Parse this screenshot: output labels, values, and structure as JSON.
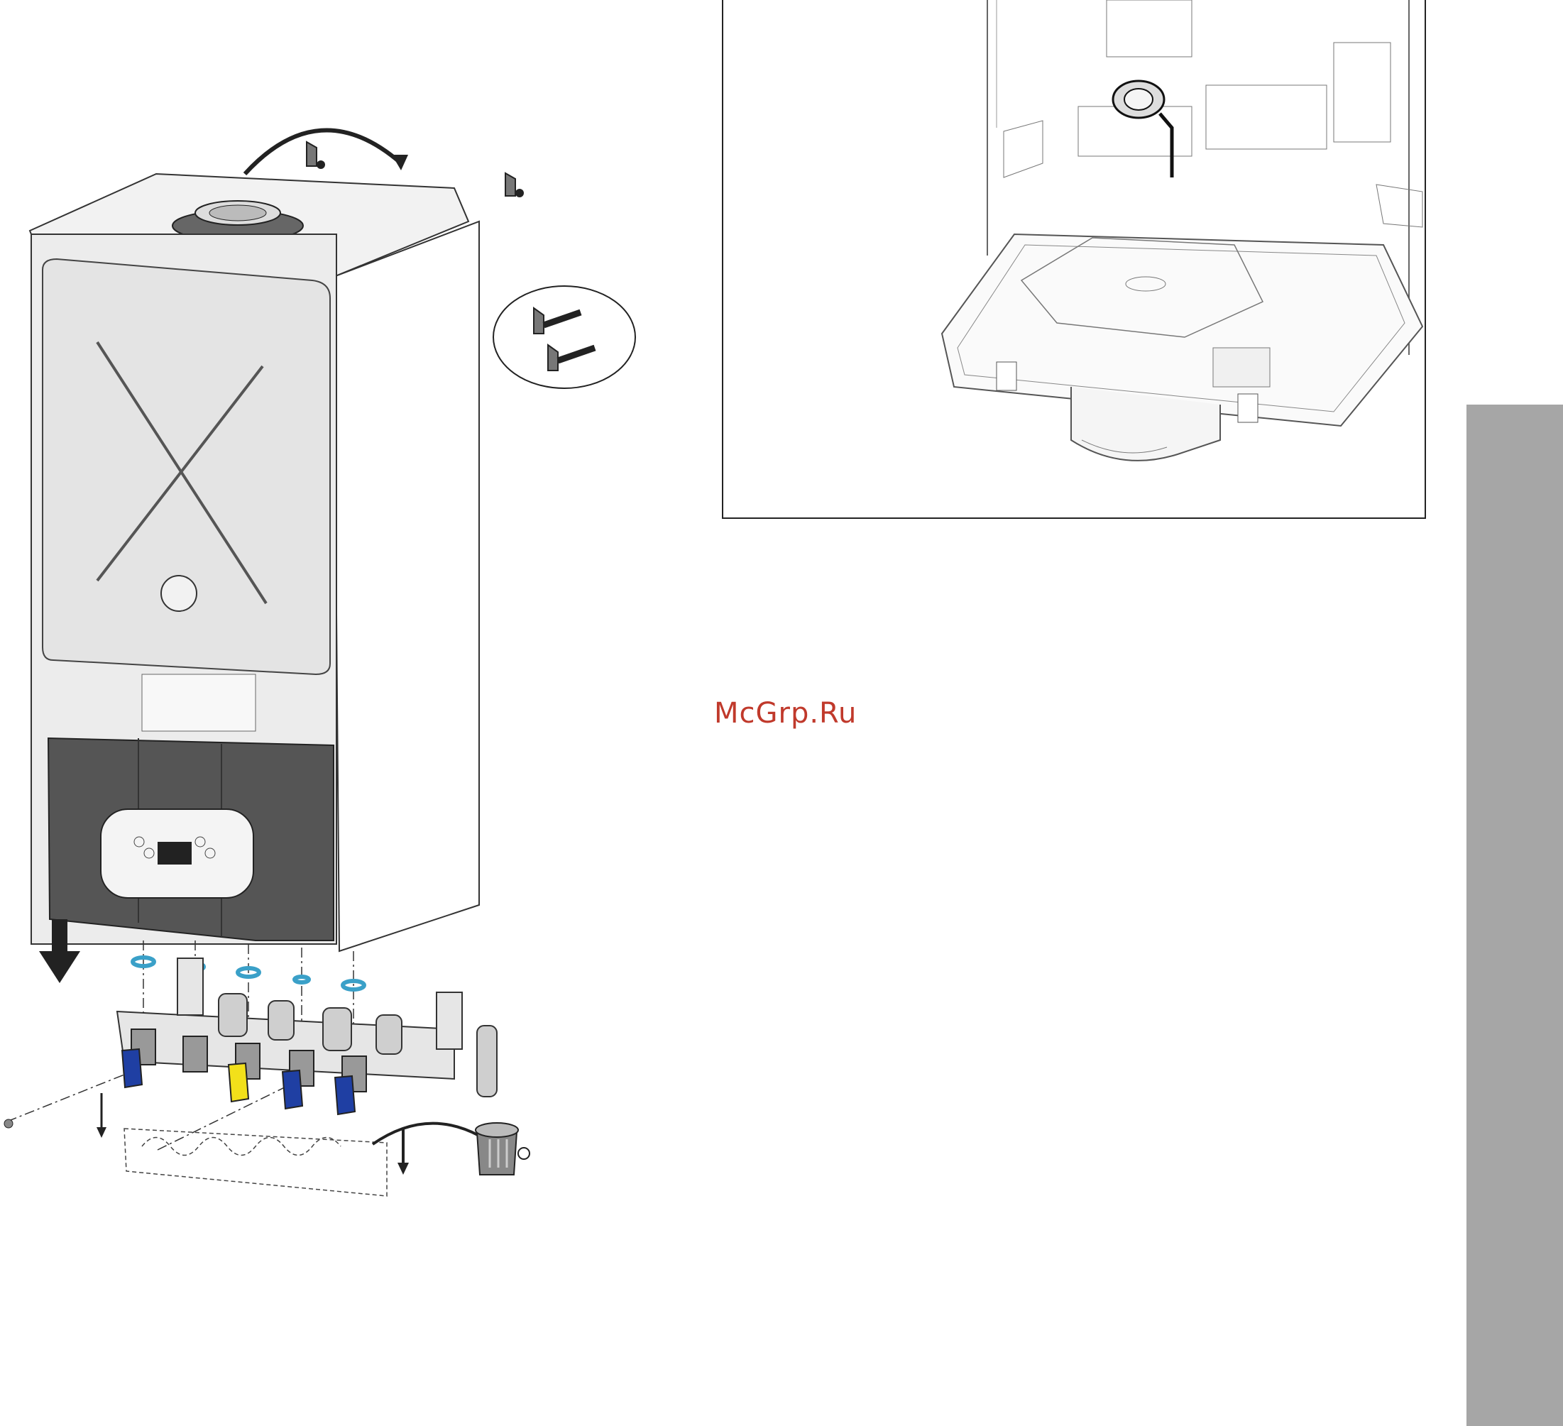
{
  "watermark": {
    "text": "McGrp.Ru",
    "color": "#c0392b"
  },
  "colors": {
    "valve_blue": "#1f3fa3",
    "valve_yellow": "#f2e01a",
    "washer": "#3aa0c8",
    "side_tab": "#a6a6a6"
  },
  "icons": [
    "bracket-icon",
    "trash-bin-icon",
    "arrow-down-icon",
    "curved-arrow-icon"
  ]
}
